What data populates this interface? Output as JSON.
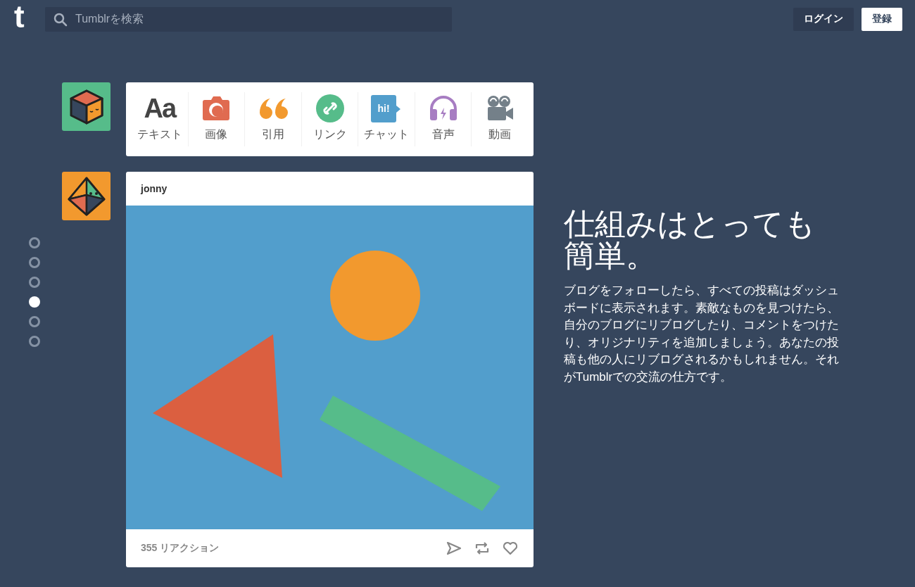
{
  "header": {
    "logo": "t",
    "search": {
      "placeholder": "Tumblrを検索"
    },
    "buttons": [
      {
        "label": "ログイン",
        "kind": "secondary"
      },
      {
        "label": "登録",
        "kind": "primary"
      }
    ]
  },
  "slides": [
    {
      "selected": false
    },
    {
      "selected": false
    },
    {
      "selected": false
    },
    {
      "selected": true
    },
    {
      "selected": false
    },
    {
      "selected": false
    }
  ],
  "post_types": [
    {
      "kind": "text",
      "label": "テキスト",
      "glyph": "Aa"
    },
    {
      "kind": "photo",
      "label": "画像"
    },
    {
      "kind": "quote",
      "label": "引用"
    },
    {
      "kind": "link",
      "label": "リンク"
    },
    {
      "kind": "chat",
      "label": "チャット",
      "glyph": "hi!"
    },
    {
      "kind": "audio",
      "label": "音声"
    },
    {
      "kind": "video",
      "label": "動画"
    }
  ],
  "post": {
    "author": "jonny",
    "notes": "355 リアクション"
  },
  "intro": {
    "heading": "仕組みはとっても簡単。",
    "body": "ブログをフォローしたら、すべての投稿はダッシュボードに表示されます。素敵なものを見つけたら、自分のブログにリブログしたり、コメントをつけたり、オリジナリティを追加しましょう。あなたの投稿も他の人にリブログされるかもしれません。それがTumblrでの交流の仕方です。"
  }
}
